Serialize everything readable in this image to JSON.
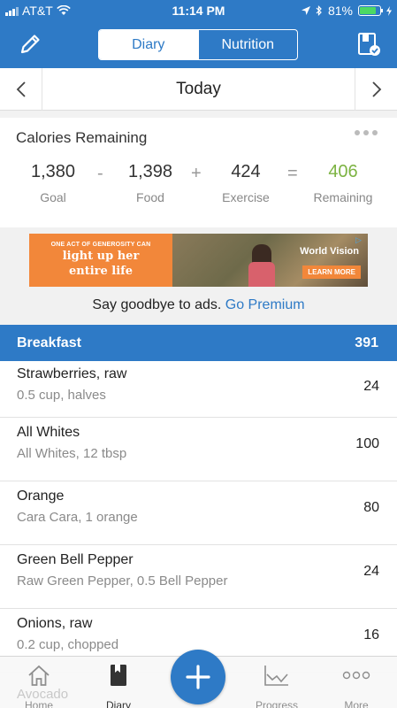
{
  "status_bar": {
    "carrier": "AT&T",
    "time": "11:14 PM",
    "battery": "81%"
  },
  "header": {
    "tabs": [
      {
        "label": "Diary",
        "active": true
      },
      {
        "label": "Nutrition",
        "active": false
      }
    ],
    "accent_color": "#2e7ac6"
  },
  "date_nav": {
    "title": "Today"
  },
  "calories": {
    "title": "Calories Remaining",
    "goal": {
      "value": "1,380",
      "label": "Goal"
    },
    "food": {
      "value": "1,398",
      "label": "Food"
    },
    "exercise": {
      "value": "424",
      "label": "Exercise"
    },
    "remaining": {
      "value": "406",
      "label": "Remaining",
      "color": "#7cb342"
    },
    "operators": [
      "-",
      "+",
      "="
    ]
  },
  "ad": {
    "small_text": "ONE ACT OF GENEROSITY CAN",
    "big_text_line1": "light up her",
    "big_text_line2": "entire life",
    "brand": "World Vision",
    "cta": "LEARN MORE",
    "promo_text": "Say goodbye to ads.",
    "promo_link": "Go Premium"
  },
  "meal": {
    "name": "Breakfast",
    "calories": "391",
    "items": [
      {
        "name": "Strawberries, raw",
        "desc": "0.5 cup, halves",
        "cal": "24"
      },
      {
        "name": "All Whites",
        "desc": "All Whites, 12 tbsp",
        "cal": "100"
      },
      {
        "name": "Orange",
        "desc": "Cara Cara, 1 orange",
        "cal": "80"
      },
      {
        "name": "Green Bell Pepper",
        "desc": "Raw Green Pepper, 0.5 Bell Pepper",
        "cal": "24"
      },
      {
        "name": "Onions, raw",
        "desc": "0.2 cup, chopped",
        "cal": "16"
      }
    ]
  },
  "tabbar": {
    "ghost_item": "Avocado",
    "tabs": [
      {
        "label": "Home",
        "icon": "home-icon"
      },
      {
        "label": "Diary",
        "icon": "diary-icon"
      },
      {
        "label": "Progress",
        "icon": "progress-icon"
      },
      {
        "label": "More",
        "icon": "more-icon"
      }
    ]
  }
}
